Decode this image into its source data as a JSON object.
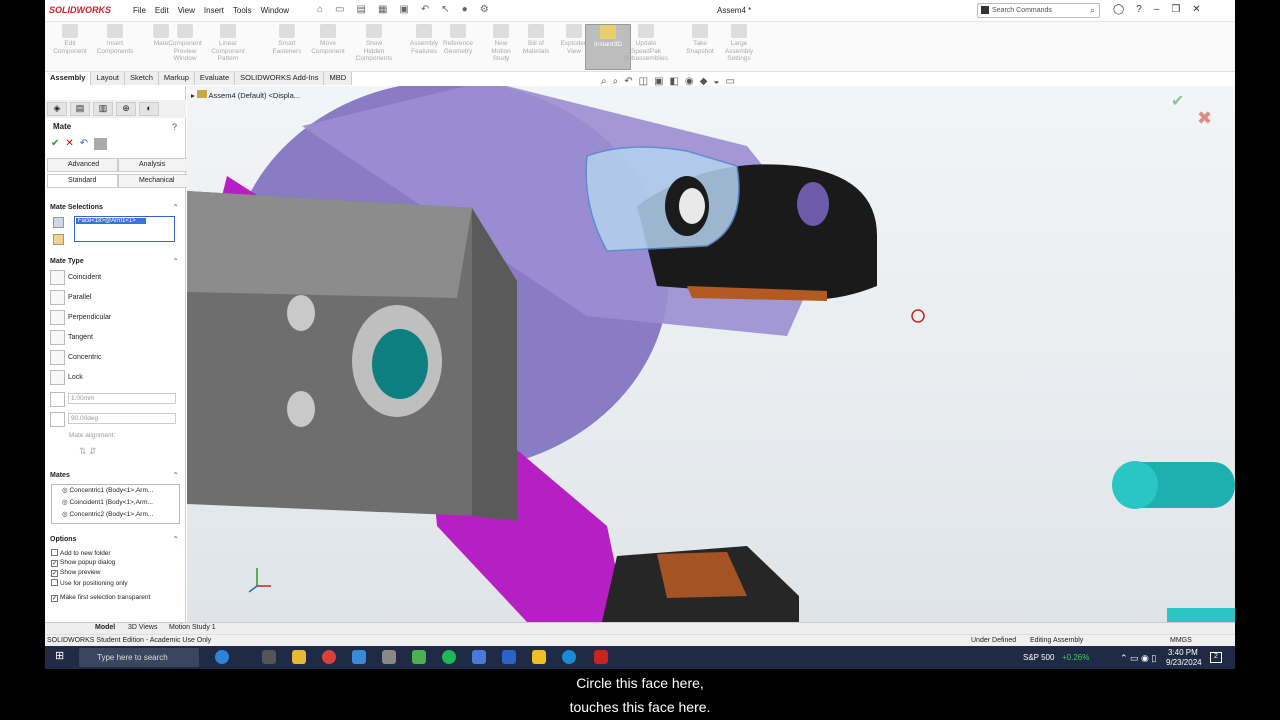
{
  "app": {
    "logo": "SOLIDWORKS",
    "doc_title": "Assem4 *"
  },
  "menus": [
    "File",
    "Edit",
    "View",
    "Insert",
    "Tools",
    "Window"
  ],
  "search": {
    "placeholder": "Search Commands"
  },
  "ribbon": [
    {
      "label": "Edit\nComponent"
    },
    {
      "label": "Insert\nComponents"
    },
    {
      "label": "Mate"
    },
    {
      "label": "Component\nPreview\nWindow"
    },
    {
      "label": "Linear Component\nPattern"
    },
    {
      "label": "Smart\nFasteners"
    },
    {
      "label": "Move\nComponent"
    },
    {
      "label": "Show\nHidden\nComponents"
    },
    {
      "label": "Assembly\nFeatures"
    },
    {
      "label": "Reference\nGeometry"
    },
    {
      "label": "New\nMotion\nStudy"
    },
    {
      "label": "Bill of\nMaterials"
    },
    {
      "label": "Exploded\nView"
    },
    {
      "label": "Instant3D",
      "active": true
    },
    {
      "label": "Update\nSpeedPak\nSubassemblies"
    },
    {
      "label": "Take\nSnapshot"
    },
    {
      "label": "Large\nAssembly\nSettings"
    }
  ],
  "cm_tabs": [
    "Assembly",
    "Layout",
    "Sketch",
    "Markup",
    "Evaluate",
    "SOLIDWORKS Add-Ins",
    "MBD"
  ],
  "panel": {
    "title": "Mate",
    "tabs": {
      "advanced": "Advanced",
      "analysis": "Analysis",
      "standard": "Standard",
      "mechanical": "Mechanical"
    },
    "mate_selections": {
      "header": "Mate Selections",
      "item": "Face<18>@Arm1<1>"
    },
    "mate_type": {
      "header": "Mate Type",
      "types": [
        "Coincident",
        "Parallel",
        "Perpendicular",
        "Tangent",
        "Concentric",
        "Lock"
      ],
      "distance": "1.00mm",
      "angle": "90.00deg",
      "alignment": "Mate alignment:"
    },
    "mates": {
      "header": "Mates",
      "items": [
        "Concentric1 (Body<1>,Arm...",
        "Coincident1 (Body<1>,Arm...",
        "Concentric2 (Body<1>,Arm..."
      ]
    },
    "options": {
      "header": "Options",
      "items": [
        {
          "label": "Add to new folder",
          "checked": false
        },
        {
          "label": "Show popup dialog",
          "checked": true
        },
        {
          "label": "Show preview",
          "checked": true
        },
        {
          "label": "Use for positioning only",
          "checked": false
        },
        {
          "label": "Make first selection transparent",
          "checked": true
        }
      ]
    }
  },
  "tree": {
    "root": "Assem4 (Default) <Displa..."
  },
  "bottom_tabs": [
    "Model",
    "3D Views",
    "Motion Study 1"
  ],
  "status": {
    "left": "SOLIDWORKS Student Edition - Academic Use Only",
    "state1": "Under Defined",
    "state2": "Editing Assembly",
    "units": "MMGS"
  },
  "taskbar": {
    "search": "Type here to search",
    "stock": "S&P 500",
    "stock_change": "+0.26%",
    "time": "3:40 PM",
    "date": "9/23/2024",
    "notif": "2"
  },
  "subtitles": [
    "Circle this face here,",
    "touches this face here."
  ]
}
